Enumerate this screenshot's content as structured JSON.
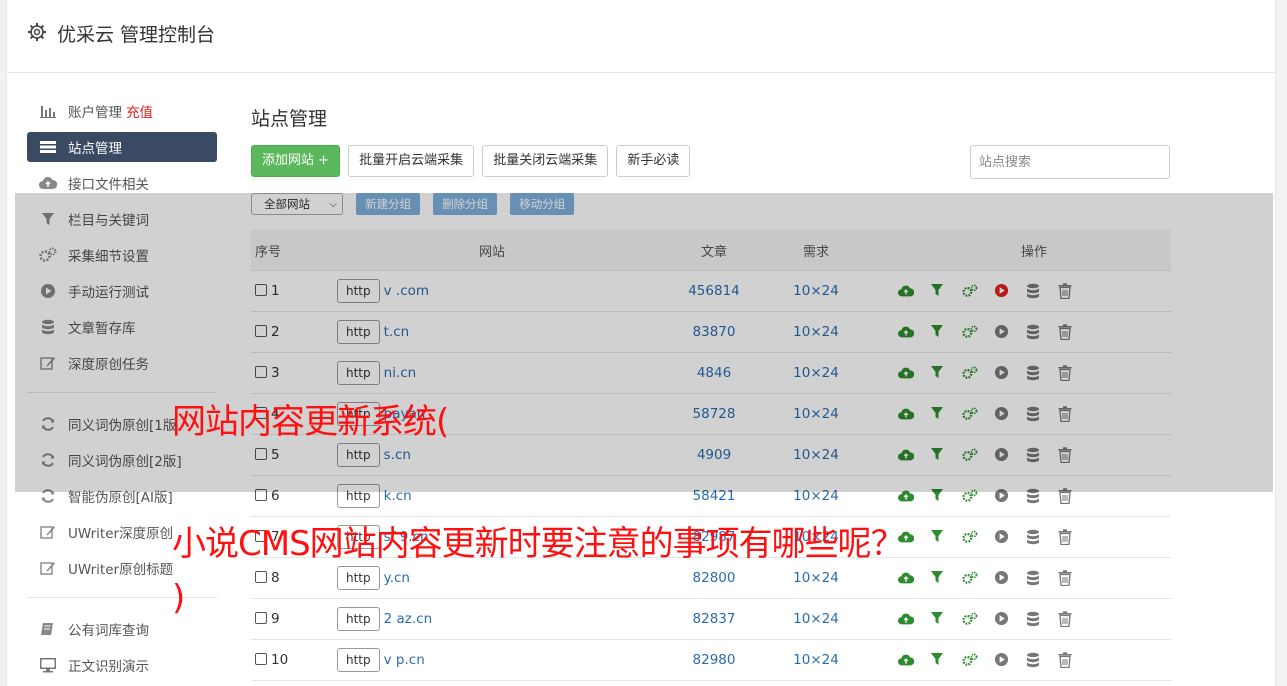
{
  "header": {
    "title": "优采云 管理控制台"
  },
  "sidebar": {
    "items": [
      {
        "label": "账户管理",
        "badge": "充值",
        "icon": "bar-chart-icon",
        "active": false
      },
      {
        "label": "站点管理",
        "icon": "server-icon",
        "active": true
      },
      {
        "label": "接口文件相关",
        "icon": "cloud-upload-icon",
        "active": false
      },
      {
        "label": "栏目与关键词",
        "icon": "filter-icon",
        "active": false
      },
      {
        "label": "采集细节设置",
        "icon": "gears-icon",
        "active": false
      },
      {
        "label": "手动运行测试",
        "icon": "play-circle-icon",
        "active": false
      },
      {
        "label": "文章暂存库",
        "icon": "database-icon",
        "active": false
      },
      {
        "label": "深度原创任务",
        "icon": "edit-icon",
        "active": false
      }
    ],
    "items2": [
      {
        "label": "同义词伪原创[1版",
        "icon": "refresh-icon"
      },
      {
        "label": "同义词伪原创[2版]",
        "icon": "refresh-icon"
      },
      {
        "label": "智能伪原创[AI版]",
        "icon": "refresh-icon"
      },
      {
        "label": "UWriter深度原创",
        "icon": "edit-icon"
      },
      {
        "label": "UWriter原创标题",
        "icon": "edit-icon"
      }
    ],
    "items3": [
      {
        "label": "公有词库查询",
        "icon": "book-icon"
      },
      {
        "label": "正文识别演示",
        "icon": "monitor-icon"
      }
    ]
  },
  "main": {
    "title": "站点管理",
    "toolbar": {
      "add_site": "添加网站 +",
      "batch_open": "批量开启云端采集",
      "batch_close": "批量关闭云端采集",
      "newbie": "新手必读",
      "search_placeholder": "站点搜索"
    },
    "subbar": {
      "group_select": "全部网站",
      "new_group": "新建分组",
      "delete_group": "删除分组",
      "move_group": "移动分组"
    },
    "table": {
      "headers": {
        "num": "序号",
        "site": "网站",
        "articles": "文章",
        "demand": "需求",
        "ops": "操作"
      },
      "rows": [
        {
          "num": "1",
          "proto": "http",
          "url": "v .com",
          "articles": "456814",
          "demand": "10×24"
        },
        {
          "num": "2",
          "proto": "http",
          "url": "t.cn",
          "articles": "83870",
          "demand": "10×24"
        },
        {
          "num": "3",
          "proto": "http",
          "url": "ni.cn",
          "articles": "4846",
          "demand": "10×24"
        },
        {
          "num": "4",
          "proto": "http",
          "url": "payan",
          "articles": "58728",
          "demand": "10×24"
        },
        {
          "num": "5",
          "proto": "http",
          "url": "s.cn",
          "articles": "4909",
          "demand": "10×24"
        },
        {
          "num": "6",
          "proto": "http",
          "url": "k.cn",
          "articles": "58421",
          "demand": "10×24"
        },
        {
          "num": "7",
          "proto": "http",
          "url": "sf 9.cn",
          "articles": "82987",
          "demand": "10×24"
        },
        {
          "num": "8",
          "proto": "http",
          "url": "y.cn",
          "articles": "82800",
          "demand": "10×24"
        },
        {
          "num": "9",
          "proto": "http",
          "url": "2 az.cn",
          "articles": "82837",
          "demand": "10×24"
        },
        {
          "num": "10",
          "proto": "http",
          "url": "v p.cn",
          "articles": "82980",
          "demand": "10×24"
        }
      ]
    }
  },
  "overlay_text": {
    "line1": "网站内容更新系统(",
    "line2": "小说CMS网站内容更新时要注意的事项有哪些呢？",
    "line3": ")"
  },
  "colors": {
    "accent_green": "#5cb85c",
    "nav_active": "#3a4a63",
    "link_blue": "#2a6cb0",
    "headline_red": "#ff1010"
  }
}
